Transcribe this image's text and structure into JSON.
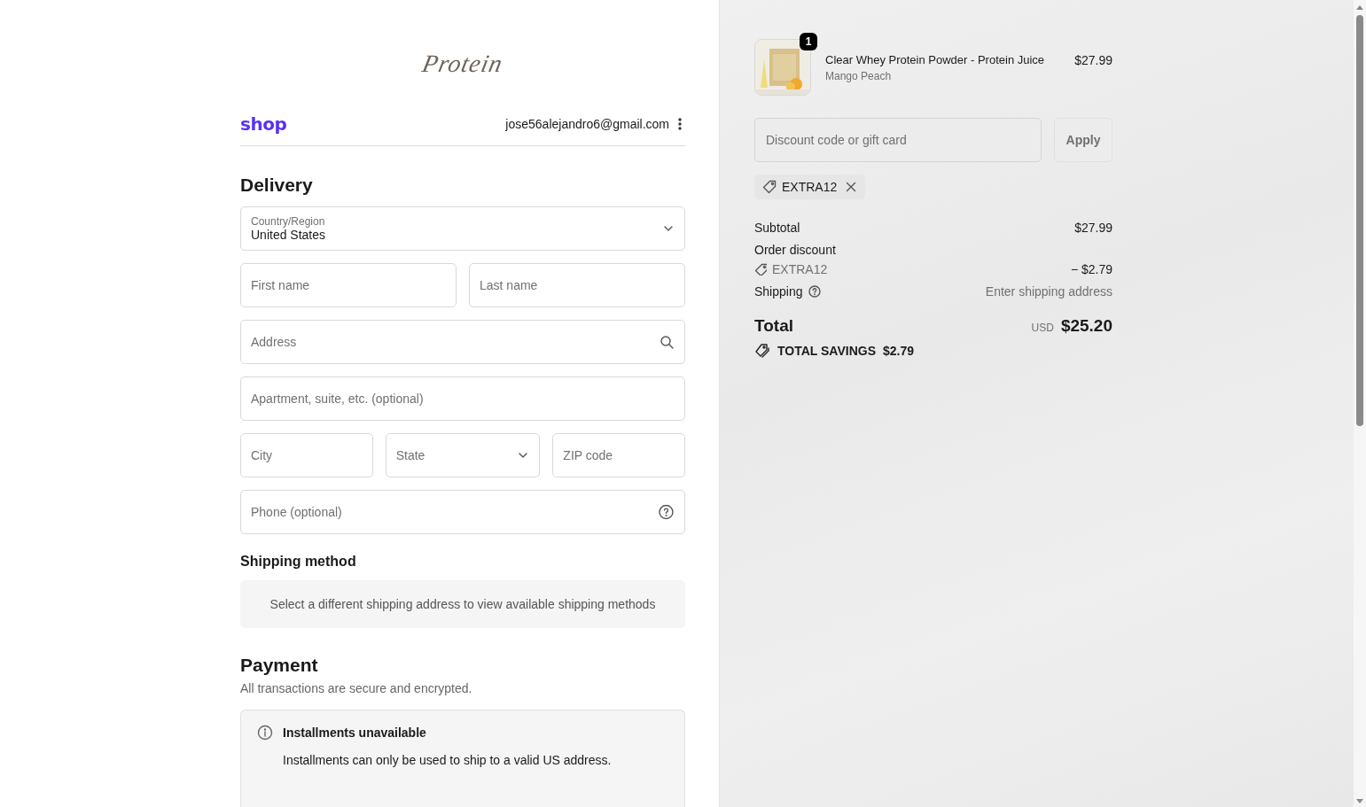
{
  "logo": "Protein",
  "account": {
    "brand": "shop",
    "email": "jose56alejandro6@gmail.com"
  },
  "delivery": {
    "heading": "Delivery",
    "rows": [
      [
        {
          "kind": "select",
          "label": "Country/Region",
          "value": "United States"
        }
      ],
      [
        {
          "kind": "text",
          "placeholder": "First name"
        },
        {
          "kind": "text",
          "placeholder": "Last name"
        }
      ],
      [
        {
          "kind": "search",
          "placeholder": "Address"
        }
      ],
      [
        {
          "kind": "text",
          "placeholder": "Apartment, suite, etc. (optional)"
        }
      ],
      [
        {
          "kind": "text",
          "placeholder": "City"
        },
        {
          "kind": "select",
          "placeholder": "State"
        },
        {
          "kind": "text",
          "placeholder": "ZIP code"
        }
      ],
      [
        {
          "kind": "help",
          "placeholder": "Phone (optional)"
        }
      ]
    ]
  },
  "shipping_method": {
    "heading": "Shipping method",
    "notice": "Select a different shipping address to view available shipping methods"
  },
  "payment": {
    "heading": "Payment",
    "subtitle": "All transactions are secure and encrypted.",
    "notice": {
      "title": "Installments unavailable",
      "text": "Installments can only be used to ship to a valid US address."
    }
  },
  "summary": {
    "items": [
      {
        "quantity": "1",
        "name": "Clear Whey Protein Powder - Protein Juice",
        "variant": "Mango Peach",
        "price": "$27.99"
      }
    ],
    "discount": {
      "placeholder": "Discount code or gift card",
      "button": "Apply"
    },
    "applied_codes": [
      "EXTRA12"
    ],
    "lines": [
      {
        "kind": "plain",
        "label": "Subtotal",
        "value": "$27.99"
      },
      {
        "kind": "discount",
        "label": "Order discount",
        "code": "EXTRA12",
        "value": "− $2.79"
      },
      {
        "kind": "help",
        "label": "Shipping",
        "value": "Enter shipping address"
      }
    ],
    "total": {
      "label": "Total",
      "currency": "USD",
      "amount": "$25.20"
    },
    "savings": {
      "label": "TOTAL SAVINGS",
      "amount": "$2.79"
    }
  }
}
